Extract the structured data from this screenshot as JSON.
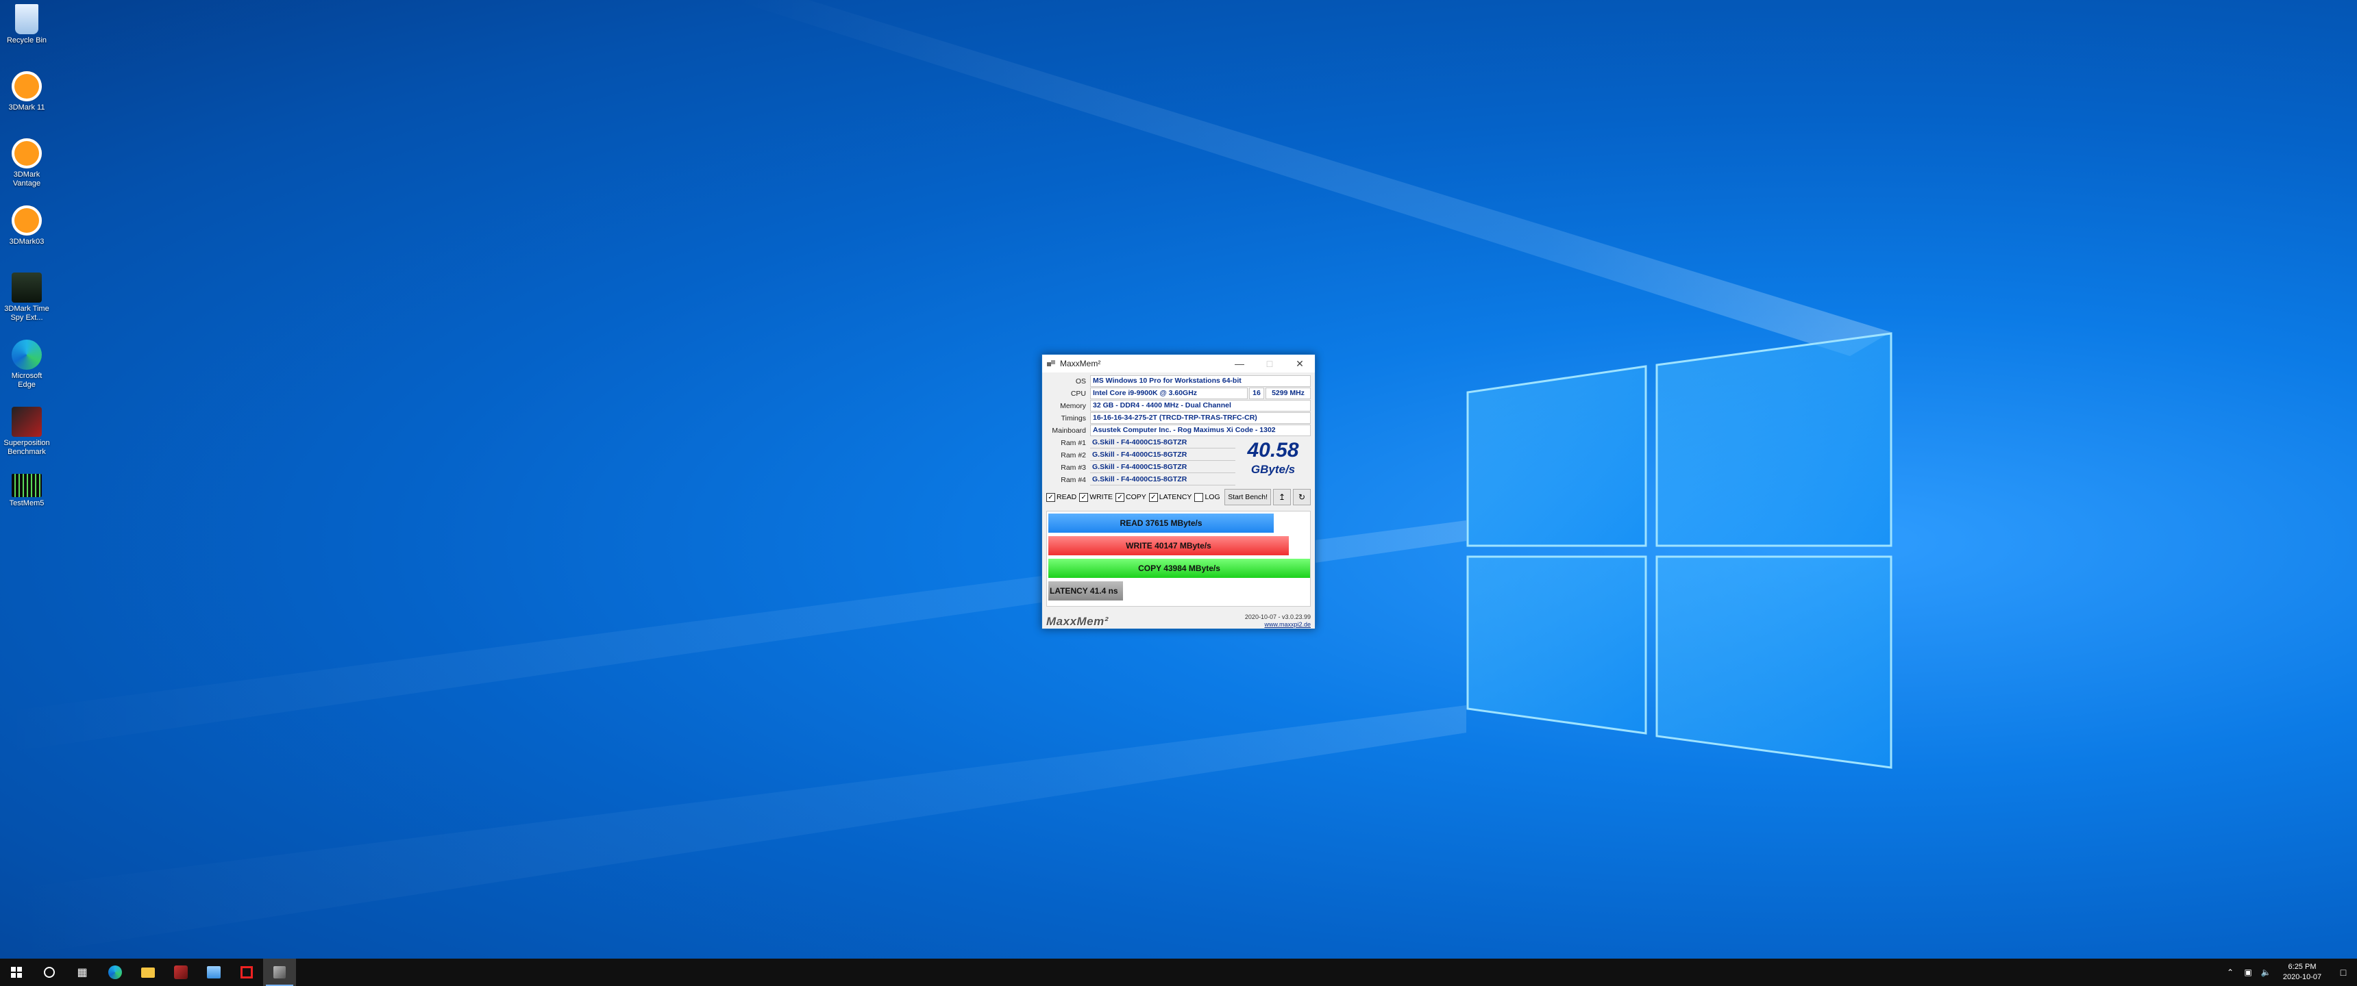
{
  "desktop": {
    "icons": [
      {
        "label": "Recycle Bin",
        "icon": "recycle-bin-icon"
      },
      {
        "label": "3DMark 11",
        "icon": "3dmark-icon"
      },
      {
        "label": "3DMark Vantage",
        "icon": "3dmark-icon"
      },
      {
        "label": "3DMark03",
        "icon": "3dmark-icon"
      },
      {
        "label": "3DMark Time Spy Ext...",
        "icon": "timespy-icon"
      },
      {
        "label": "Microsoft Edge",
        "icon": "edge-icon"
      },
      {
        "label": "Superposition Benchmark",
        "icon": "superposition-icon"
      },
      {
        "label": "TestMem5",
        "icon": "testmem-icon"
      }
    ]
  },
  "window": {
    "title": "MaxxMem²",
    "info": {
      "os_label": "OS",
      "os_value": "MS Windows 10 Pro for Workstations 64-bit",
      "cpu_label": "CPU",
      "cpu_value": "Intel Core i9-9900K @ 3.60GHz",
      "cpu_threads": "16",
      "cpu_mhz": "5299 MHz",
      "memory_label": "Memory",
      "memory_value": "32 GB - DDR4 - 4400 MHz - Dual Channel",
      "timings_label": "Timings",
      "timings_value": "16-16-16-34-275-2T (TRCD-TRP-TRAS-TRFC-CR)",
      "mainboard_label": "Mainboard",
      "mainboard_value": "Asustek Computer Inc. - Rog Maximus Xi Code - 1302"
    },
    "rams": [
      {
        "label": "Ram #1",
        "value": "G.Skill - F4-4000C15-8GTZR"
      },
      {
        "label": "Ram #2",
        "value": "G.Skill - F4-4000C15-8GTZR"
      },
      {
        "label": "Ram #3",
        "value": "G.Skill - F4-4000C15-8GTZR"
      },
      {
        "label": "Ram #4",
        "value": "G.Skill - F4-4000C15-8GTZR"
      }
    ],
    "score": {
      "value": "40.58",
      "unit": "GByte/s"
    },
    "checks": [
      {
        "label": "READ",
        "checked": true
      },
      {
        "label": "WRITE",
        "checked": true
      },
      {
        "label": "COPY",
        "checked": true
      },
      {
        "label": "LATENCY",
        "checked": true
      },
      {
        "label": "LOG",
        "checked": false
      }
    ],
    "start_button": "Start Bench!",
    "results": {
      "read": {
        "label": "READ  37615  MByte/s",
        "fraction": 0.86
      },
      "write": {
        "label": "WRITE  40147  MByte/s",
        "fraction": 0.92
      },
      "copy": {
        "label": "COPY  43984  MByte/s",
        "fraction": 1.0
      },
      "latency": {
        "label": "LATENCY  41.4  ns",
        "fraction": 0.28
      }
    },
    "footer": {
      "logo": "MaxxMem²",
      "version": "2020-10-07 - v3.0.23.99",
      "link": "www.maxxpi2.de"
    }
  },
  "taskbar": {
    "time": "6:25 PM",
    "date": "2020-10-07"
  }
}
